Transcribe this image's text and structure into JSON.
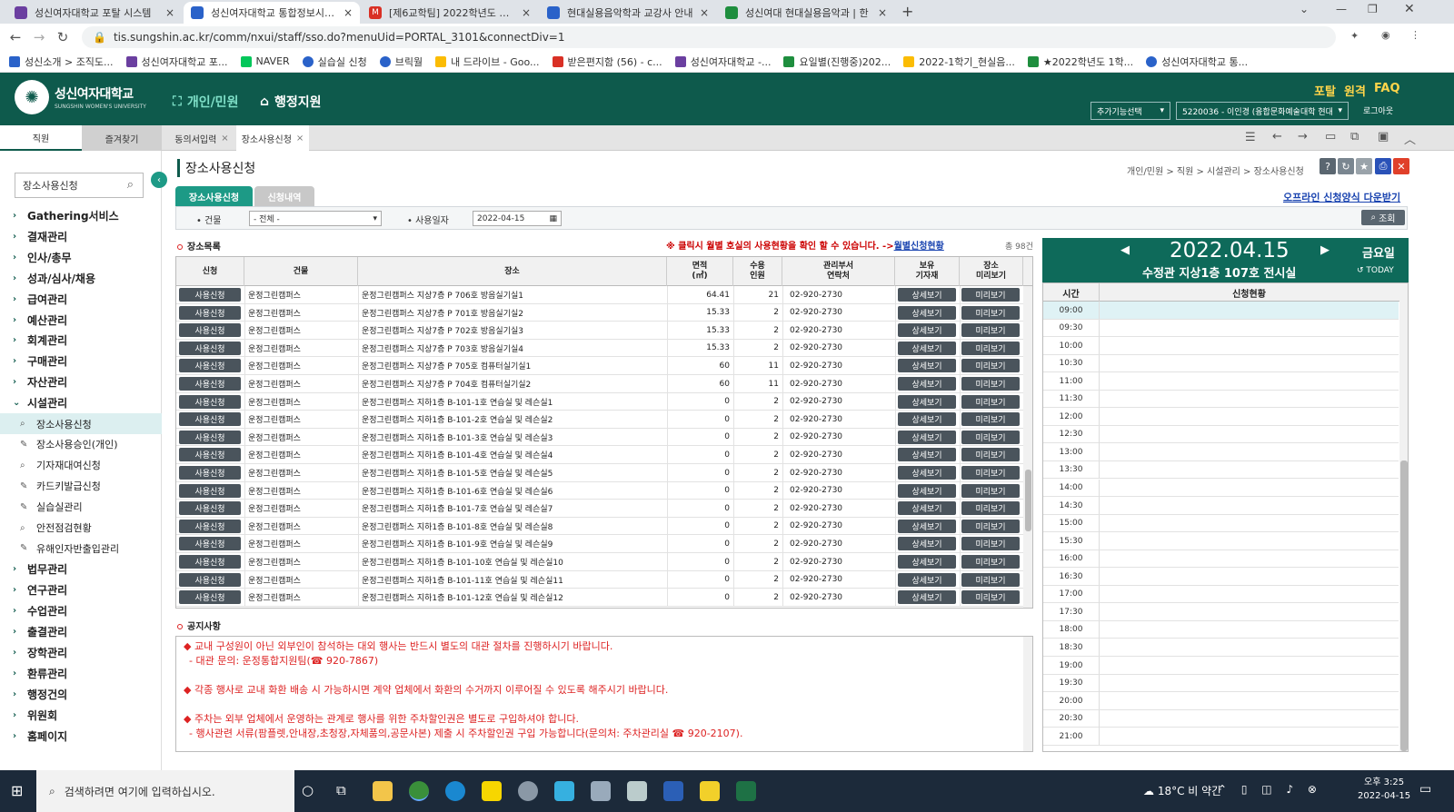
{
  "browser": {
    "tabs": [
      {
        "title": "성신여자대학교 포탈 시스템",
        "color": "#6b3fa0"
      },
      {
        "title": "성신여자대학교 통합정보시스템",
        "color": "#2a62c9"
      },
      {
        "title": "[제6교학팀] 2022학년도 여름계...",
        "color": "#d93025"
      },
      {
        "title": "현대실용음악학과 교강사 안내",
        "color": "#2a62c9"
      },
      {
        "title": "성신여대 현대실용음악과 | 한",
        "color": "#1e8e3e"
      }
    ],
    "url": "tis.sungshin.ac.kr/comm/nxui/staff/sso.do?menuUid=PORTAL_3101&connectDiv=1",
    "bookmarks": [
      "성신소개 > 조직도...",
      "성신여자대학교 포...",
      "NAVER",
      "실습실 신청",
      "브릭월",
      "내 드라이브 - Goo...",
      "받은편지함 (56) - c...",
      "성신여자대학교 -...",
      "요일별(진행중)202...",
      "2022-1학기_현실음...",
      "★2022학년도 1학...",
      "성신여자대학교 통..."
    ]
  },
  "header": {
    "logo_name": "성신여자대학교",
    "logo_sub": "SUNGSHIN WOMEN'S UNIVERSITY",
    "menu1": "개인/민원",
    "menu2": "행정지원",
    "links": [
      "포탈",
      "원격",
      "FAQ"
    ],
    "extra_select": "추가기능선택",
    "user_select": "5220036 - 이인경 (융합문화예술대학 현대",
    "logout": "로그아웃"
  },
  "apptabs": {
    "left1": "직원",
    "left2": "즐겨찾기",
    "tab1": "동의서입력",
    "tab2": "장소사용신청"
  },
  "sidebar": {
    "search": "장소사용신청",
    "menus": [
      "Gathering서비스",
      "결재관리",
      "인사/총무",
      "성과/심사/채용",
      "급여관리",
      "예산관리",
      "회계관리",
      "구매관리",
      "자산관리",
      "시설관리"
    ],
    "subs": [
      "장소사용신청",
      "장소사용승인(개인)",
      "기자재대여신청",
      "카드키발급신청",
      "실습실관리",
      "안전점검현황",
      "유해인자반출입관리"
    ],
    "menus2": [
      "법무관리",
      "연구관리",
      "수업관리",
      "출결관리",
      "장학관리",
      "환류관리",
      "행정건의",
      "위원회",
      "홈페이지"
    ]
  },
  "page": {
    "title": "장소사용신청",
    "breadcrumb": "개인/민원 > 직원 > 시설관리 > 장소사용신청",
    "subtab1": "장소사용신청",
    "subtab2": "신청내역",
    "offline": "오프라인 신청양식 다운받기",
    "filter_building_label": "• 건물",
    "filter_building_value": "- 전체 -",
    "filter_date_label": "• 사용일자",
    "filter_date_value": "2022-04-15",
    "search_btn": "조회",
    "list_title": "장소목록",
    "hint": "※ 클릭시 월별 호실의 사용현황을 확인 할 수 있습니다. ->",
    "hint_link": "월별신청현황",
    "count": "총 98건"
  },
  "table": {
    "headers": [
      "신청",
      "건물",
      "장소",
      "면적\n(㎡)",
      "수용\n인원",
      "관리부서\n연락처",
      "보유\n기자재",
      "장소\n미리보기"
    ],
    "apply_btn": "사용신청",
    "detail_btn": "상세보기",
    "preview_btn": "미리보기",
    "rows": [
      [
        "운정그린캠퍼스",
        "운정그린캠퍼스 지상7층 P 706호 방음실기실1",
        "64.41",
        "21",
        "02-920-2730"
      ],
      [
        "운정그린캠퍼스",
        "운정그린캠퍼스 지상7층 P 701호 방음실기실2",
        "15.33",
        "2",
        "02-920-2730"
      ],
      [
        "운정그린캠퍼스",
        "운정그린캠퍼스 지상7층 P 702호 방음실기실3",
        "15.33",
        "2",
        "02-920-2730"
      ],
      [
        "운정그린캠퍼스",
        "운정그린캠퍼스 지상7층 P 703호 방음실기실4",
        "15.33",
        "2",
        "02-920-2730"
      ],
      [
        "운정그린캠퍼스",
        "운정그린캠퍼스 지상7층 P 705호 컴퓨터실기실1",
        "60",
        "11",
        "02-920-2730"
      ],
      [
        "운정그린캠퍼스",
        "운정그린캠퍼스 지상7층 P 704호 컴퓨터실기실2",
        "60",
        "11",
        "02-920-2730"
      ],
      [
        "운정그린캠퍼스",
        "운정그린캠퍼스 지하1층 B-101-1호 연습실 및 레슨실1",
        "0",
        "2",
        "02-920-2730"
      ],
      [
        "운정그린캠퍼스",
        "운정그린캠퍼스 지하1층 B-101-2호 연습실 및 레슨실2",
        "0",
        "2",
        "02-920-2730"
      ],
      [
        "운정그린캠퍼스",
        "운정그린캠퍼스 지하1층 B-101-3호 연습실 및 레슨실3",
        "0",
        "2",
        "02-920-2730"
      ],
      [
        "운정그린캠퍼스",
        "운정그린캠퍼스 지하1층 B-101-4호 연습실 및 레슨실4",
        "0",
        "2",
        "02-920-2730"
      ],
      [
        "운정그린캠퍼스",
        "운정그린캠퍼스 지하1층 B-101-5호 연습실 및 레슨실5",
        "0",
        "2",
        "02-920-2730"
      ],
      [
        "운정그린캠퍼스",
        "운정그린캠퍼스 지하1층 B-101-6호 연습실 및 레슨실6",
        "0",
        "2",
        "02-920-2730"
      ],
      [
        "운정그린캠퍼스",
        "운정그린캠퍼스 지하1층 B-101-7호 연습실 및 레슨실7",
        "0",
        "2",
        "02-920-2730"
      ],
      [
        "운정그린캠퍼스",
        "운정그린캠퍼스 지하1층 B-101-8호 연습실 및 레슨실8",
        "0",
        "2",
        "02-920-2730"
      ],
      [
        "운정그린캠퍼스",
        "운정그린캠퍼스 지하1층 B-101-9호 연습실 및 레슨실9",
        "0",
        "2",
        "02-920-2730"
      ],
      [
        "운정그린캠퍼스",
        "운정그린캠퍼스 지하1층 B-101-10호 연습실 및 레슨실10",
        "0",
        "2",
        "02-920-2730"
      ],
      [
        "운정그린캠퍼스",
        "운정그린캠퍼스 지하1층 B-101-11호 연습실 및 레슨실11",
        "0",
        "2",
        "02-920-2730"
      ],
      [
        "운정그린캠퍼스",
        "운정그린캠퍼스 지하1층 B-101-12호 연습실 및 레슨실12",
        "0",
        "2",
        "02-920-2730"
      ]
    ]
  },
  "notice": {
    "title": "공지사항",
    "lines": [
      "◆ 교내 구성원이 아닌 외부인이 참석하는 대외 행사는 반드시 별도의 대관 절차를 진행하시기 바랍니다.",
      "- 대관 문의: 운정통합지원팀(☎ 920-7867)",
      "◆ 각종 행사로 교내 화환 배송 시 가능하시면 계약 업체에서 화환의 수거까지 이루어질 수 있도록 해주시기 바랍니다.",
      "◆ 주차는 외부 업체에서 운영하는 관계로 행사를 위한 주차할인권은 별도로 구입하셔야 합니다.",
      "- 행사관련 서류(팜플렛,안내장,초청장,자체품의,공문사본) 제출 시 주차할인권 구입 가능합니다(문의처: 주차관리실 ☎ 920-2107)."
    ]
  },
  "calendar": {
    "date": "2022.04.15",
    "day": "금요일",
    "place": "수정관 지상1층 107호 전시실",
    "today": "TODAY",
    "col_time": "시간",
    "col_status": "신청현황",
    "slots": [
      "09:00",
      "09:30",
      "10:00",
      "10:30",
      "11:00",
      "11:30",
      "12:00",
      "12:30",
      "13:00",
      "13:30",
      "14:00",
      "14:30",
      "15:00",
      "15:30",
      "16:00",
      "16:30",
      "17:00",
      "17:30",
      "18:00",
      "18:30",
      "19:00",
      "19:30",
      "20:00",
      "20:30",
      "21:00"
    ]
  },
  "taskbar": {
    "search": "검색하려면 여기에 입력하십시오.",
    "weather": "18°C 비 약간",
    "time": "오후 3:25",
    "date": "2022-04-15"
  }
}
